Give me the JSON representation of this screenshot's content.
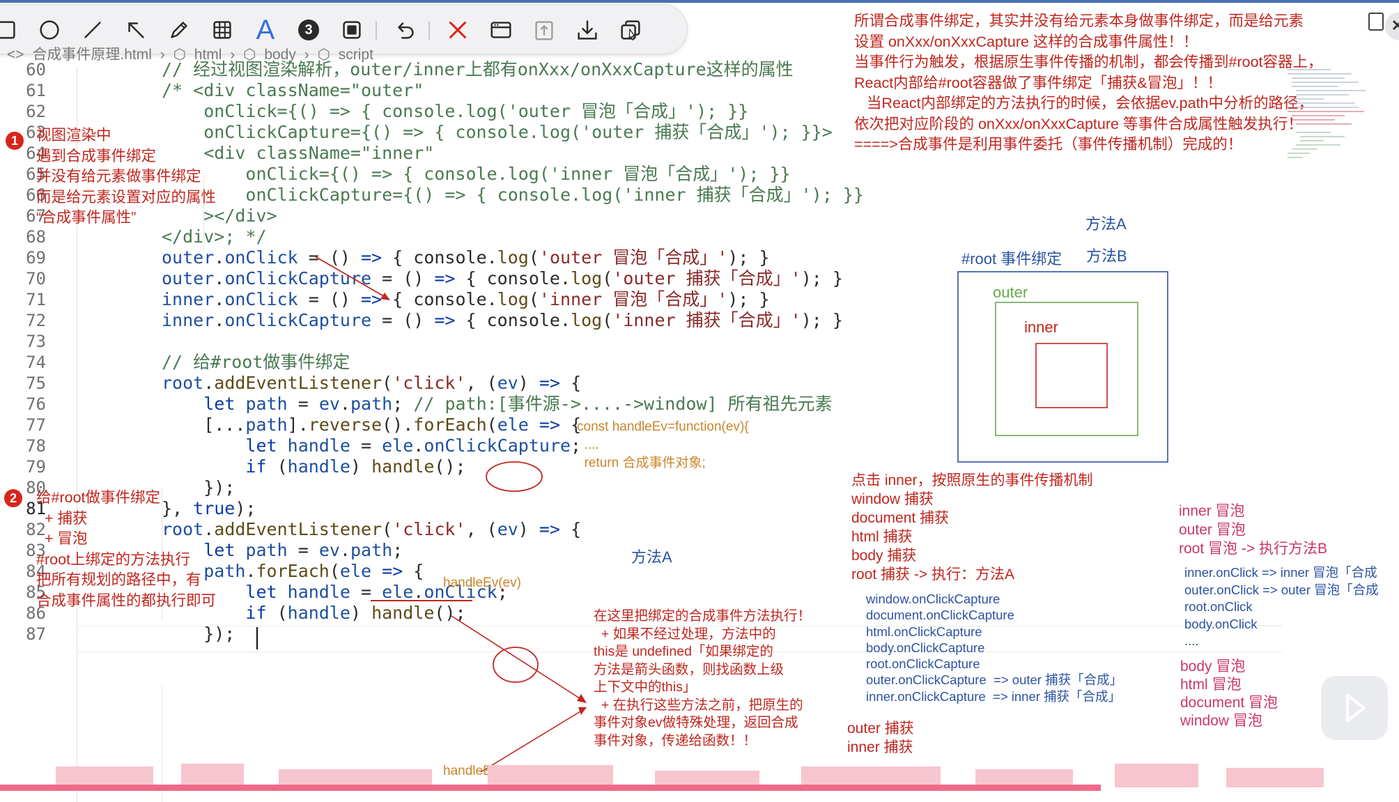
{
  "toolbar": {
    "tools": [
      "rectangle-tool",
      "circle-tool",
      "line-tool",
      "arrow-tool",
      "pen-tool",
      "mosaic-tool",
      "text-tool",
      "number-tool",
      "blur-tool",
      "undo-tool",
      "close-tool",
      "window-tool",
      "pin-tool",
      "download-tool",
      "copy-tool"
    ],
    "text_tool_label": "A",
    "number_tool_label": "3"
  },
  "breadcrumb": [
    "合成事件原理.html",
    "html",
    "body",
    "script"
  ],
  "code_lines": [
    {
      "n": "60",
      "html": "<span class='cmt'>// 经过视图渲染解析，outer/inner上都有onXxx/onXxxCapture这样的属性</span>"
    },
    {
      "n": "61",
      "html": "<span class='cmt'>/* &lt;div className=\"outer\"</span>"
    },
    {
      "n": "62",
      "html": "<span class='cmt'>    onClick={() =&gt; { console.log('outer 冒泡「合成」'); }}</span>"
    },
    {
      "n": "63",
      "html": "<span class='cmt'>    onClickCapture={() =&gt; { console.log('outer 捕获「合成」'); }}&gt;</span>"
    },
    {
      "n": "64",
      "html": "<span class='cmt'>    &lt;div className=\"inner\"</span>"
    },
    {
      "n": "65",
      "html": "<span class='cmt'>        onClick={() =&gt; { console.log('inner 冒泡「合成」'); }}</span>"
    },
    {
      "n": "66",
      "html": "<span class='cmt'>        onClickCapture={() =&gt; { console.log('inner 捕获「合成」'); }}</span>"
    },
    {
      "n": "67",
      "html": "<span class='cmt'>    &gt;&lt;/div&gt;</span>"
    },
    {
      "n": "68",
      "html": "<span class='cmt'>&lt;/div&gt;; */</span>"
    },
    {
      "n": "69",
      "html": "<span class='id'>outer</span>.<span class='id'>onClick</span> = () <span class='kw'>=&gt;</span> { console.<span class='fn'>log</span>(<span class='str'>'outer 冒泡「合成」'</span>); }"
    },
    {
      "n": "70",
      "html": "<span class='id'>outer</span>.<span class='id'>onClickCapture</span> = () <span class='kw'>=&gt;</span> { console.<span class='fn'>log</span>(<span class='str'>'outer 捕获「合成」'</span>); }"
    },
    {
      "n": "71",
      "html": "<span class='id'>inner</span>.<span class='id'>onClick</span> = () <span class='kw'>=&gt;</span> { console.<span class='fn'>log</span>(<span class='str'>'inner 冒泡「合成」'</span>); }"
    },
    {
      "n": "72",
      "html": "<span class='id'>inner</span>.<span class='id'>onClickCapture</span> = () <span class='kw'>=&gt;</span> { console.<span class='fn'>log</span>(<span class='str'>'inner 捕获「合成」'</span>); }"
    },
    {
      "n": "73",
      "html": ""
    },
    {
      "n": "74",
      "html": "<span class='cmt'>// 给#root做事件绑定</span>"
    },
    {
      "n": "75",
      "html": "<span class='id'>root</span>.<span class='fn'>addEventListener</span>(<span class='str'>'click'</span>, (<span class='id'>ev</span>) <span class='kw'>=&gt;</span> {"
    },
    {
      "n": "76",
      "html": "    <span class='kw'>let</span> <span class='id'>path</span> = <span class='id'>ev</span>.<span class='id'>path</span>; <span class='cmt'>// path:[事件源-&gt;....-&gt;window] 所有祖先元素</span>"
    },
    {
      "n": "77",
      "html": "    [...<span class='id'>path</span>].<span class='fn'>reverse</span>().<span class='fn'>forEach</span>(<span class='id'>ele</span> <span class='kw'>=&gt;</span> {"
    },
    {
      "n": "78",
      "html": "        <span class='kw'>let</span> <span class='id'>handle</span> = <span class='id'>ele</span>.<span class='id'>onClickCapture</span>;"
    },
    {
      "n": "79",
      "html": "        <span class='kw'>if</span> (<span class='id'>handle</span>) <span class='fn'>handle</span>();"
    },
    {
      "n": "80",
      "html": "    });"
    },
    {
      "n": "81",
      "html": "}, <span class='kw'>true</span>);"
    },
    {
      "n": "82",
      "html": "<span class='id'>root</span>.<span class='fn'>addEventListener</span>(<span class='str'>'click'</span>, (<span class='id'>ev</span>) <span class='kw'>=&gt;</span> {"
    },
    {
      "n": "83",
      "html": "    <span class='kw'>let</span> <span class='id'>path</span> = <span class='id'>ev</span>.<span class='id'>path</span>;"
    },
    {
      "n": "84",
      "html": "    <span class='id'>path</span>.<span class='fn'>forEach</span>(<span class='id'>ele</span> <span class='kw'>=&gt;</span> {"
    },
    {
      "n": "85",
      "html": "        <span class='kw'>let</span> <span class='id'>handle</span> = <span class='id'>ele</span>.<span class='id'>onClick</span>;"
    },
    {
      "n": "86",
      "html": "        <span class='kw'>if</span> (<span class='id'>handle</span>) <span class='fn'>handle</span>();"
    },
    {
      "n": "87",
      "html": "    });"
    }
  ],
  "annotations": {
    "top_note": "所谓合成事件绑定，其实并没有给元素本身做事件绑定，而是给元素\n设置 onXxx/onXxxCapture 这样的合成事件属性！！\n当事件行为触发，根据原生事件传播的机制，都会传播到#root容器上，\nReact内部给#root容器做了事件绑定「捕获&冒泡」！！\n   当React内部绑定的方法执行的时候，会依据ev.path中分析的路径，\n依次把对应阶段的 onXxx/onXxxCapture 等事件合成属性触发执行！\n====>合成事件是利用事件委托（事件传播机制）完成的！",
    "badge1": "1",
    "note1": "视图渲染中\n遇到合成事件绑定\n并没有给元素做事件绑定\n而是给元素设置对应的属性\n“合成事件属性”",
    "badge2": "2",
    "note2": "给#root做事件绑定\n  + 捕获\n  + 冒泡\n#root上绑定的方法执行\n把所有规划的路径中，有\n合成事件属性的都执行即可",
    "method_a_top": "方法A",
    "root_bind": "#root 事件绑定",
    "method_b_top": "方法B",
    "outer_label": "outer",
    "inner_label": "inner",
    "handle_ev_def": "const handleEv=function(ev){\n  ....\n  return 合成事件对象;",
    "method_a_mid": "方法A",
    "handle_ev_1": "handleEv(ev)",
    "handle_ev_2": "handleEv(ev)",
    "exec_note": "在这里把绑定的合成事件方法执行！\n  + 如果不经过处理，方法中的\nthis是 undefined「如果绑定的\n方法是箭头函数，则找函数上级\n上下文中的this」\n  + 在执行这些方法之前，把原生的\n事件对象ev做特殊处理，返回合成\n事件对象，传递给函数！！",
    "capture_flow": "点击 inner，按照原生的事件传播机制\nwindow 捕获\ndocument 捕获\nhtml 捕获\nbody 捕获\nroot 捕获 -> 执行：方法A",
    "capture_list": "window.onClickCapture\ndocument.onClickCapture\nhtml.onClickCapture\nbody.onClickCapture\nroot.onClickCapture\nouter.onClickCapture  => outer 捕获「合成」\ninner.onClickCapture  => inner 捕获「合成」",
    "capture_tail": "outer 捕获\ninner 捕获",
    "bubble_flow": "inner 冒泡\nouter 冒泡\nroot 冒泡 -> 执行方法B",
    "bubble_list": "inner.onClick => inner 冒泡「合成\nouter.onClick => outer 冒泡「合成\nroot.onClick\nbody.onClick\n....",
    "bubble_tail": "body 冒泡\nhtml 冒泡\ndocument 冒泡\nwindow 冒泡"
  },
  "colors": {
    "accent_red": "#c0271f",
    "note_blue": "#2b53a3",
    "outer_green": "#6aa74e",
    "bubble_pink": "#c8376c",
    "progress_pink": "#f06a8a"
  }
}
